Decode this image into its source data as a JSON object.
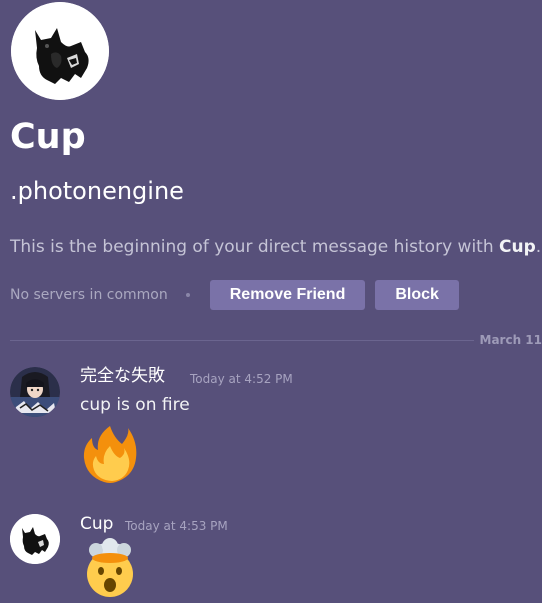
{
  "profile": {
    "display_name": "Cup",
    "username": ".photonengine",
    "intro_text_prefix": "This is the beginning of your direct message history with ",
    "intro_text_name": "Cup",
    "intro_text_suffix": ".",
    "avatar_icon": "black-cat-icon"
  },
  "actions": {
    "mutual_servers": "No servers in common",
    "remove_friend_label": "Remove Friend",
    "block_label": "Block"
  },
  "divider": {
    "date": "March 11"
  },
  "messages": [
    {
      "author": "完全な失敗",
      "timestamp": "Today at 4:52 PM",
      "text": "cup is on fire",
      "emoji": "fire-emoji",
      "avatar_icon": "anime-character-avatar"
    },
    {
      "author": "Cup",
      "timestamp": "Today at 4:53 PM",
      "text": "",
      "emoji": "exploding-head-emoji",
      "avatar_icon": "black-cat-icon"
    }
  ],
  "colors": {
    "background": "#57507a",
    "button": "#7a72a8",
    "text_primary": "#f2f3f5",
    "text_muted": "#a7a3c0"
  }
}
